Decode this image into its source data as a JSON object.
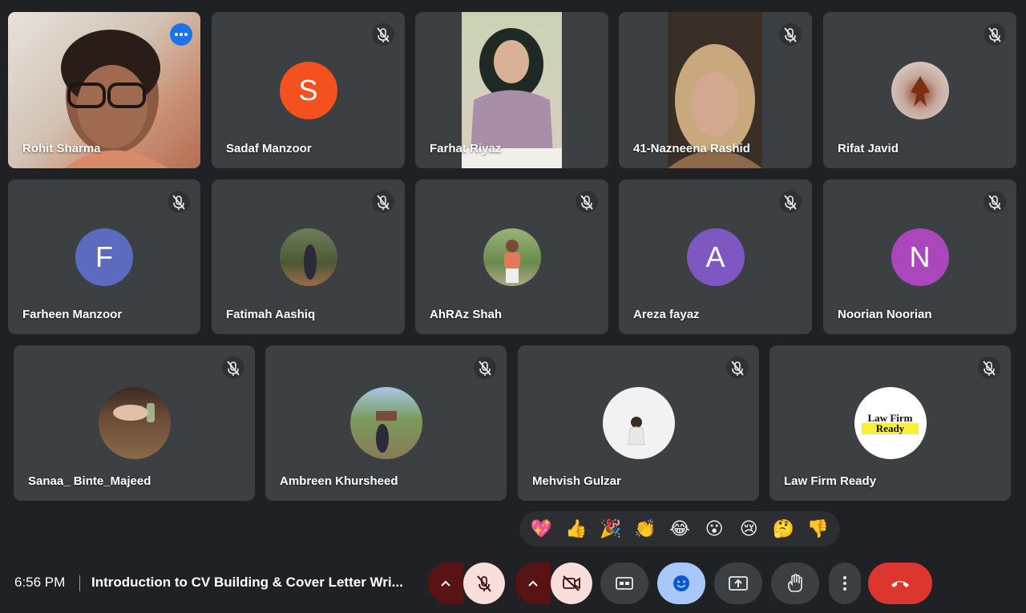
{
  "participants_row1": [
    {
      "name": "Rohit Sharma"
    },
    {
      "name": "Sadaf Manzoor",
      "initial": "S"
    },
    {
      "name": "Farhat Riyaz"
    },
    {
      "name": "41-Nazneena Rashid"
    },
    {
      "name": "Rifat Javid"
    }
  ],
  "participants_row2": [
    {
      "name": "Farheen Manzoor",
      "initial": "F"
    },
    {
      "name": "Fatimah Aashiq"
    },
    {
      "name": "AhRAz Shah"
    },
    {
      "name": "Areza fayaz",
      "initial": "A"
    },
    {
      "name": "Noorian Noorian",
      "initial": "N"
    }
  ],
  "participants_row3": [
    {
      "name": "Sanaa_ Binte_Majeed"
    },
    {
      "name": "Ambreen Khursheed"
    },
    {
      "name": "Mehvish Gulzar"
    },
    {
      "name": "Law Firm Ready",
      "logo_line1": "Law Firm",
      "logo_line2": "Ready"
    }
  ],
  "reactions": [
    "💖",
    "👍",
    "🎉",
    "👏",
    "😂",
    "😮",
    "😢",
    "🤔",
    "👎"
  ],
  "meeting": {
    "time": "6:56 PM",
    "title": "Introduction to CV Building & Cover Letter Wri..."
  },
  "colors": {
    "background": "#202124",
    "tile": "#3c4043",
    "active_border": "#8ab4f8",
    "avatar_s": "#f4511e",
    "avatar_f": "#5c6bc0",
    "avatar_a": "#7e57c2",
    "avatar_n": "#ab47bc",
    "leave": "#dc362e"
  },
  "icons": {
    "mute": "mic-off-icon",
    "more": "more-horiz-icon",
    "camera_off": "videocam-off-icon",
    "captions": "closed-caption-icon",
    "emoji": "emoji-icon",
    "present": "present-screen-icon",
    "hand": "raise-hand-icon",
    "options": "more-vert-icon",
    "leave": "call-end-icon",
    "chevron": "chevron-up-icon"
  }
}
